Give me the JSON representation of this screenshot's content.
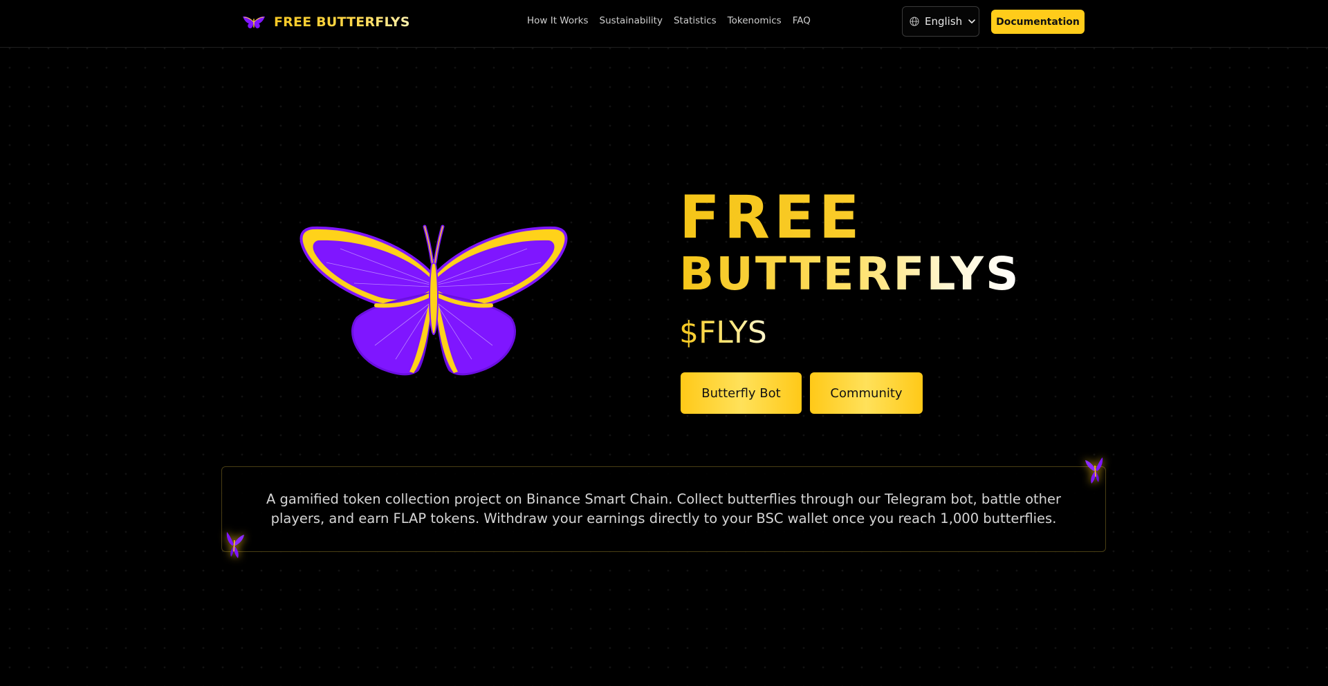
{
  "header": {
    "brand": "FREE BUTTERFLYS",
    "brand_icon": "butterfly-icon",
    "nav": [
      {
        "label": "How It Works"
      },
      {
        "label": "Sustainability"
      },
      {
        "label": "Statistics"
      },
      {
        "label": "Tokenomics"
      },
      {
        "label": "FAQ"
      }
    ],
    "language": {
      "selected": "English",
      "icon": "globe-icon"
    },
    "documentation_label": "Documentation"
  },
  "hero": {
    "title_line1": "FREE",
    "title_line2": "BUTTERFLYS",
    "ticker": "$FLYS",
    "buttons": {
      "bot": "Butterfly Bot",
      "community": "Community"
    }
  },
  "description": "A gamified token collection project on Binance Smart Chain. Collect butterflies through our Telegram bot, battle other players, and earn FLAP tokens. Withdraw your earnings directly to your BSC wallet once you reach 1,000 butterflies.",
  "colors": {
    "accent": "#ffcc1a",
    "butterfly_wing": "#7f16ff",
    "background": "#000000"
  }
}
